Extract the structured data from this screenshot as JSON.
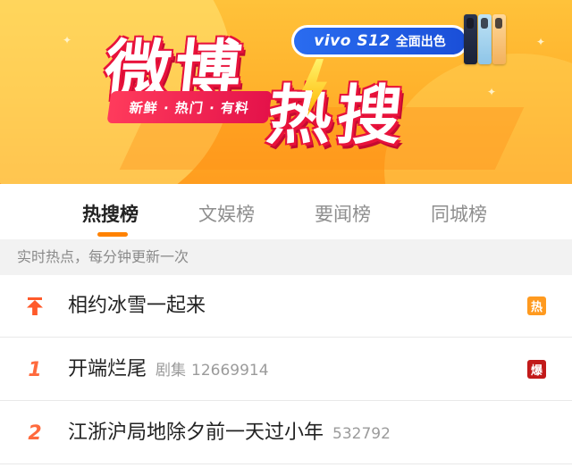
{
  "banner": {
    "title_top": "微博",
    "title_bottom": "热搜",
    "tagline": "新鲜 · 热门 · 有料",
    "promo": {
      "brand": "vivo S12",
      "text": "全面出色"
    },
    "colors": {
      "bg": "#ffb02a",
      "title_stroke": "#e8123b",
      "promo_bg": "#2a6cf0"
    }
  },
  "tabs": [
    {
      "label": "热搜榜",
      "active": true
    },
    {
      "label": "文娱榜",
      "active": false
    },
    {
      "label": "要闻榜",
      "active": false
    },
    {
      "label": "同城榜",
      "active": false
    }
  ],
  "subhead": "实时热点，每分钟更新一次",
  "list": [
    {
      "rank": "",
      "rank_icon": "pin-top-icon",
      "title": "相约冰雪一起来",
      "category": "",
      "count": "",
      "badge": "热",
      "badge_color": "#ff9a1f"
    },
    {
      "rank": "1",
      "title": "开端烂尾",
      "category": "剧集",
      "count": "12669914",
      "badge": "爆",
      "badge_color": "#c21a1a"
    },
    {
      "rank": "2",
      "title": "江浙沪局地除夕前一天过小年",
      "category": "",
      "count": "532792",
      "badge": "",
      "badge_color": ""
    }
  ]
}
